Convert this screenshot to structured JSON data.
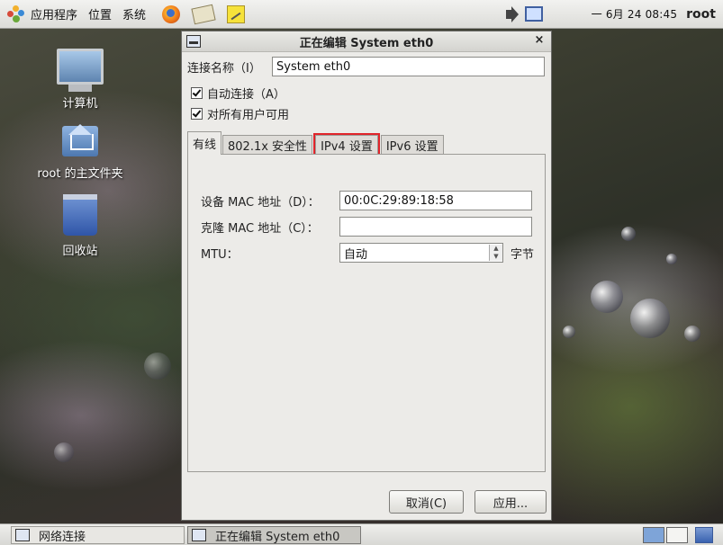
{
  "top_panel": {
    "menus": [
      "应用程序",
      "位置",
      "系统"
    ],
    "clock": "一 6月 24 08:45",
    "user": "root"
  },
  "desktop": {
    "icons": [
      "计算机",
      "root 的主文件夹",
      "回收站"
    ]
  },
  "dialog": {
    "title": "正在编辑 System eth0",
    "close": "×",
    "connection_name_label": "连接名称（I）",
    "connection_name_value": "System eth0",
    "auto_connect_label": "自动连接（A）",
    "all_users_label": "对所有用户可用",
    "tabs": [
      "有线",
      "802.1x 安全性",
      "IPv4 设置",
      "IPv6 设置"
    ],
    "active_tab": "有线",
    "highlighted_tab": "IPv4 设置",
    "device_mac_label": "设备  MAC 地址（D）：",
    "device_mac_value": "00:0C:29:89:18:58",
    "cloned_mac_label": "克隆  MAC 地址（C）：",
    "cloned_mac_value": "",
    "mtu_label": "MTU：",
    "mtu_value": "自动",
    "mtu_unit": "字节",
    "cancel_button": "取消(C)",
    "apply_button": "应用..."
  },
  "bottom_panel": {
    "tasks": [
      "网络连接",
      "正在编辑 System eth0"
    ]
  }
}
